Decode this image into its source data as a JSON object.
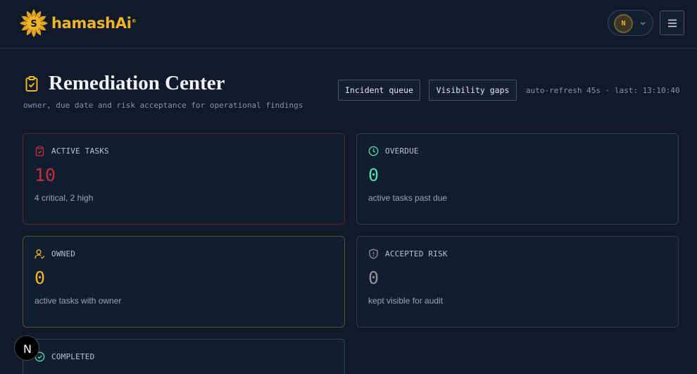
{
  "header": {
    "logo_text": "hamashAi",
    "logo_mark": "S",
    "logo_reg": "®",
    "user_initial": "N",
    "icons": {
      "chevron": "chevron-down-icon",
      "menu": "hamburger-menu-icon"
    }
  },
  "page": {
    "title": "Remediation Center",
    "subtitle": "owner, due date and risk acceptance for operational findings",
    "icon": "clipboard-check-icon"
  },
  "toolbar": {
    "incident_queue": "Incident queue",
    "visibility_gaps": "Visibility gaps",
    "refresh_status": "auto-refresh 45s · last: 13:10:40"
  },
  "cards": {
    "active": {
      "label": "ACTIVE TASKS",
      "value": "10",
      "desc": "4 critical, 2 high",
      "icon": "clipboard-check-icon"
    },
    "overdue": {
      "label": "OVERDUE",
      "value": "0",
      "desc": "active tasks past due",
      "icon": "clock-icon"
    },
    "owned": {
      "label": "OWNED",
      "value": "0",
      "desc": "active tasks with owner",
      "icon": "user-check-icon"
    },
    "accepted": {
      "label": "ACCEPTED RISK",
      "value": "0",
      "desc": "kept visible for audit",
      "icon": "shield-alert-icon"
    },
    "completed": {
      "label": "COMPLETED",
      "icon": "check-circle-icon"
    }
  },
  "colors": {
    "brand": "#f0b429",
    "critical": "#c0303d",
    "success": "#4ee0a8",
    "warning": "#f0b429",
    "muted": "#8c939c"
  },
  "dev_badge": {
    "letter": "N"
  }
}
